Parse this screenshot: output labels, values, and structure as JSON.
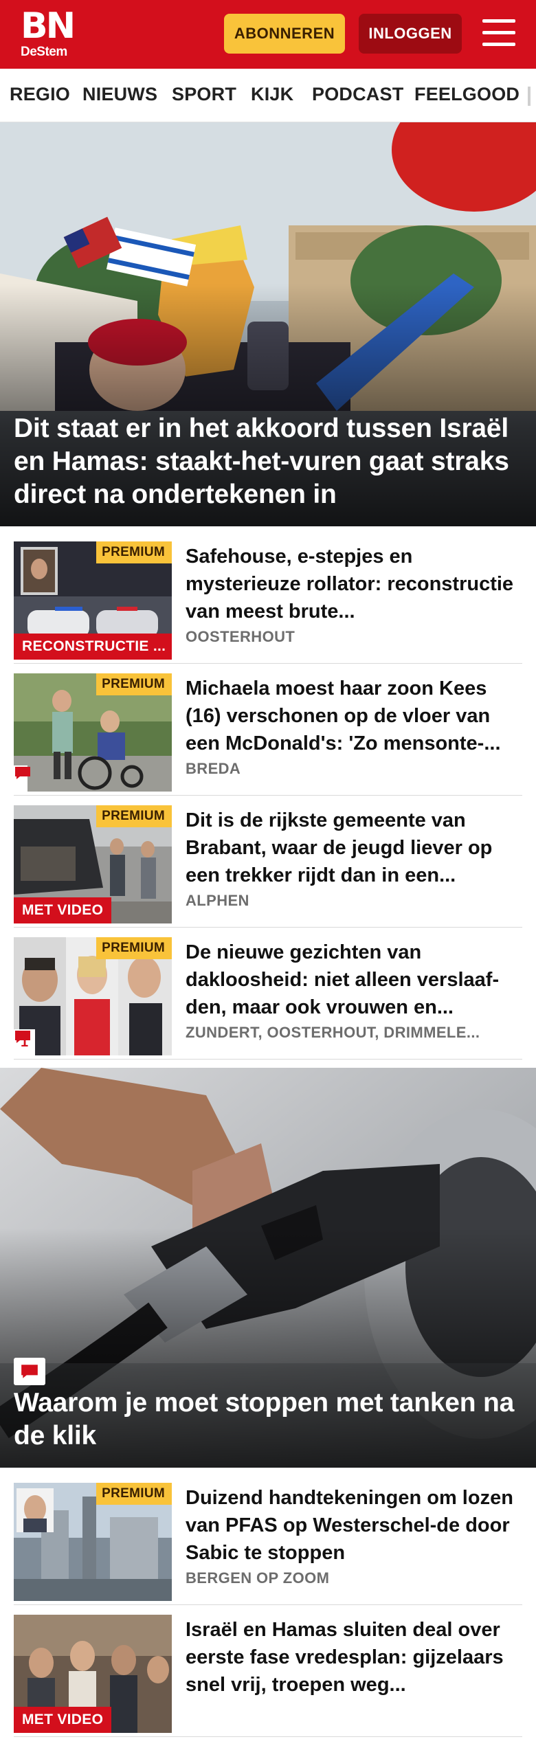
{
  "header": {
    "logo_main": "BN",
    "logo_sub": "DeStem",
    "subscribe_label": "ABONNEREN",
    "login_label": "INLOGGEN",
    "brand_color": "#d30f1c",
    "accent_color": "#f9c33a"
  },
  "nav": {
    "items": [
      "REGIO",
      "NIEUWS",
      "SPORT",
      "KIJK",
      "PODCAST",
      "FEELGOOD"
    ]
  },
  "hero1": {
    "title": "Dit staat er in het akkoord tussen Israël en Hamas: staakt-het-vuren gaat straks direct na ondertekenen in"
  },
  "articles": [
    {
      "badge": "PREMIUM",
      "label": "RECONSTRUCTIE ...",
      "title": "Safehouse, e-stepjes en mysterieuze rollator: reconstructie van meest brute...",
      "location": "OOSTERHOUT"
    },
    {
      "badge": "PREMIUM",
      "comments": "",
      "title": "Michaela moest haar zoon Kees (16) verschonen op de vloer van een McDonald's: 'Zo mensonte-...",
      "location": "BREDA"
    },
    {
      "badge": "PREMIUM",
      "label": "MET VIDEO",
      "title": "Dit is de rijkste gemeente van Brabant, waar de jeugd liever op een trekker rijdt dan in een...",
      "location": "ALPHEN"
    },
    {
      "badge": "PREMIUM",
      "comments": "1",
      "title": "De nieuwe gezichten van dakloosheid: niet alleen verslaaf-den, maar ook vrouwen en...",
      "location": "ZUNDERT, OOSTERHOUT, DRIMMELE..."
    }
  ],
  "hero2": {
    "title": "Waarom je moet stoppen met tanken na de klik"
  },
  "articles2": [
    {
      "badge": "PREMIUM",
      "title": "Duizend handtekeningen om lozen van PFAS op Westerschel-de door Sabic te stoppen",
      "location": "BERGEN OP ZOOM"
    },
    {
      "label": "MET VIDEO",
      "title": "Israël en Hamas sluiten deal over eerste fase vredesplan: gijzelaars snel vrij, troepen weg..."
    }
  ]
}
